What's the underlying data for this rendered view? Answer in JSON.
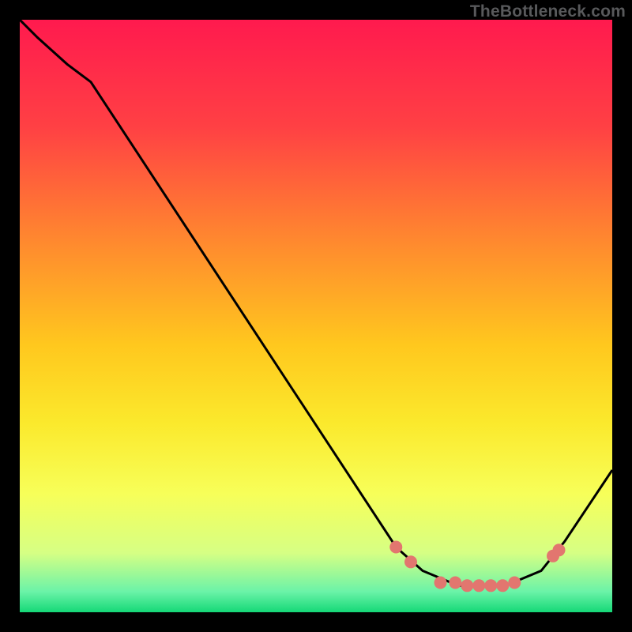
{
  "watermark": "TheBottleneck.com",
  "chart_data": {
    "type": "line",
    "title": "",
    "xlabel": "",
    "ylabel": "",
    "xlim": [
      0,
      100
    ],
    "ylim": [
      0,
      100
    ],
    "series": [
      {
        "name": "curve",
        "x": [
          0,
          3,
          8,
          12,
          63.5,
          68,
          74,
          82,
          88,
          92,
          100
        ],
        "y": [
          100,
          97,
          92.5,
          89.5,
          11,
          7,
          4.5,
          4.5,
          7,
          12,
          24
        ]
      }
    ],
    "markers": {
      "name": "dots",
      "x": [
        63.5,
        66,
        71,
        73.5,
        75.5,
        77.5,
        79.5,
        81.5,
        83.5,
        90,
        91
      ],
      "y": [
        11,
        8.5,
        5,
        5,
        4.5,
        4.5,
        4.5,
        4.5,
        5,
        9.5,
        10.5
      ]
    },
    "background_gradient": [
      {
        "offset": 0.0,
        "color": "#ff1a4e"
      },
      {
        "offset": 0.18,
        "color": "#ff4044"
      },
      {
        "offset": 0.38,
        "color": "#ff8b2e"
      },
      {
        "offset": 0.55,
        "color": "#ffc81e"
      },
      {
        "offset": 0.68,
        "color": "#fbe92c"
      },
      {
        "offset": 0.8,
        "color": "#f7ff59"
      },
      {
        "offset": 0.9,
        "color": "#d6ff84"
      },
      {
        "offset": 0.965,
        "color": "#6bf3a8"
      },
      {
        "offset": 1.0,
        "color": "#15d877"
      }
    ],
    "curve_color": "#000000",
    "marker_color": "#e2766f"
  }
}
